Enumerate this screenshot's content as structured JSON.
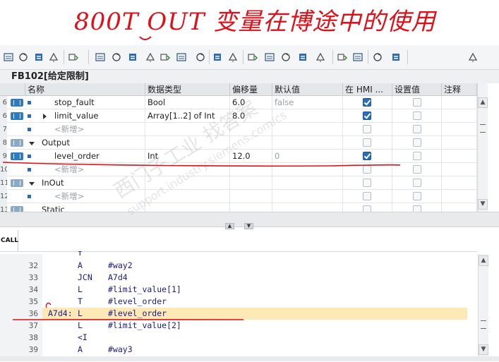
{
  "annotation": {
    "title": "800T OUT 变量在博途中的使用"
  },
  "toolbar": {
    "icons": [
      "insert-row-icon",
      "delete-row-icon",
      "insert-network-icon",
      "delete-network-icon",
      "block-icon",
      "list-icon",
      "monitor-icon",
      "table-icon",
      "comment-icon",
      "download-icon",
      "upload-icon",
      "interface-icon",
      "expand-icon",
      "watch-icon",
      "refresh-icon",
      "breakpoint-icon",
      "step-icon",
      "run-icon",
      "check-icon",
      "branch-icon",
      "sequence-icon",
      "diagnostic-icon",
      "glasses-icon",
      "callstack-icon"
    ]
  },
  "block": {
    "title": "FB102[给定限制]"
  },
  "table": {
    "columns": [
      "名称",
      "数据类型",
      "偏移量",
      "默认值",
      "在 HMI ...",
      "设置值",
      "注释"
    ],
    "rows": [
      {
        "num": "6",
        "kind": "var",
        "indent": 1,
        "expander": "",
        "name": "stop_fault",
        "type": "Bool",
        "offset": "6.0",
        "default": "false",
        "hmi": true,
        "setval": false
      },
      {
        "num": "6",
        "kind": "var",
        "indent": 1,
        "expander": "right",
        "name": "limit_value",
        "type": "Array[1..2] of Int",
        "offset": "8.0",
        "default": "",
        "hmi": true,
        "setval": false
      },
      {
        "num": "7",
        "kind": "new",
        "indent": 1,
        "expander": "",
        "name": "<新增>",
        "type": "",
        "offset": "",
        "default": "",
        "hmi": false,
        "setval": false
      },
      {
        "num": "8",
        "kind": "section",
        "indent": 0,
        "expander": "down",
        "name": "Output",
        "type": "",
        "offset": "",
        "default": "",
        "hmi": false,
        "setval": false
      },
      {
        "num": "9",
        "kind": "var",
        "indent": 1,
        "expander": "",
        "name": "level_order",
        "type": "Int",
        "offset": "12.0",
        "default": "0",
        "hmi": true,
        "setval": false
      },
      {
        "num": "10",
        "kind": "new",
        "indent": 1,
        "expander": "",
        "name": "<新增>",
        "type": "",
        "offset": "",
        "default": "",
        "hmi": false,
        "setval": false
      },
      {
        "num": "11",
        "kind": "section",
        "indent": 0,
        "expander": "down",
        "name": "InOut",
        "type": "",
        "offset": "",
        "default": "",
        "hmi": false,
        "setval": false
      },
      {
        "num": "12",
        "kind": "new",
        "indent": 1,
        "expander": "",
        "name": "<新增>",
        "type": "",
        "offset": "",
        "default": "",
        "hmi": false,
        "setval": false
      },
      {
        "num": "13",
        "kind": "section",
        "indent": 0,
        "expander": "",
        "name": "Static",
        "type": "",
        "offset": "",
        "default": "",
        "hmi": false,
        "setval": false
      }
    ]
  },
  "lower": {
    "tab": "CALL"
  },
  "code": {
    "partial_top": "I",
    "lines": [
      {
        "num": "32",
        "label": "",
        "op": "A",
        "arg": "#way2",
        "highlight": false
      },
      {
        "num": "33",
        "label": "",
        "op": "JCN",
        "arg": "A7d4",
        "highlight": false
      },
      {
        "num": "34",
        "label": "",
        "op": "L",
        "arg": "#limit_value[1]",
        "highlight": false
      },
      {
        "num": "35",
        "label": "",
        "op": "T",
        "arg": "#level_order",
        "highlight": false
      },
      {
        "num": "36",
        "label": "A7d4:",
        "op": "L",
        "arg": "#level_order",
        "highlight": true
      },
      {
        "num": "37",
        "label": "",
        "op": "L",
        "arg": "#limit_value[2]",
        "highlight": false
      },
      {
        "num": "38",
        "label": "",
        "op": "<I",
        "arg": "",
        "highlight": false
      },
      {
        "num": "39",
        "label": "",
        "op": "A",
        "arg": "#way3",
        "highlight": false
      }
    ]
  },
  "watermark": {
    "line1": "西门子工业 找答案",
    "line2": "support.industry.siemens.com/cs"
  },
  "colors": {
    "annotation_red": "#e0101a",
    "highlight": "#fde9b6",
    "checkbox_blue": "#2b6fb8"
  }
}
